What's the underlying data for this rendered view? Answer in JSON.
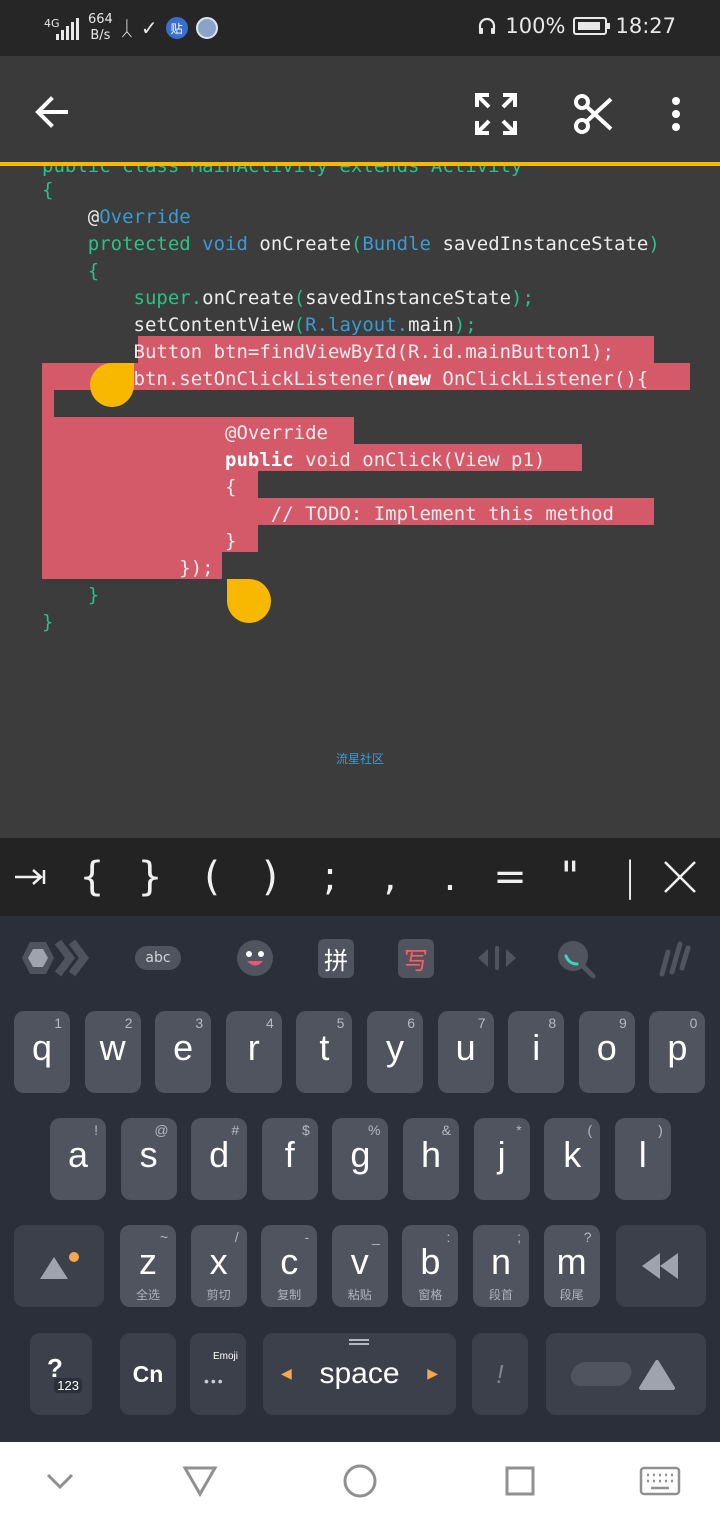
{
  "status_bar": {
    "network": "4G",
    "speed_value": "664",
    "speed_unit": "B/s",
    "tie_badge": "贴",
    "battery": "100%",
    "time": "18:27"
  },
  "code": {
    "line0": "public class MainActivity extends Activity",
    "line1": "{",
    "line2_at": "@",
    "line2_rest": "Override",
    "line3_kw": "protected",
    "line3_type": "void",
    "line3_name": "onCreate",
    "line3_paren": "(",
    "line3_param_type": "Bundle",
    "line3_param": "savedInstanceState",
    "line3_close": ")",
    "line4": "{",
    "line5_super": "super",
    "line5_dot": ".",
    "line5_call": "onCreate",
    "line5_open": "(",
    "line5_arg": "savedInstanceState",
    "line5_close": ");",
    "line6_call": "setContentView",
    "line6_open": "(",
    "line6_arg": "R.layout.",
    "line6_arg2": "main",
    "line6_close": ");",
    "line7": "Button btn=findViewById(R.id.mainButton1);",
    "line8_a": "btn.setOnClickListener(",
    "line8_new": "new",
    "line8_b": " OnClickListener(){",
    "line10": "@Override",
    "line11_kw": "public",
    "line11_rest": " void onClick(View p1)",
    "line12": "{",
    "line13": "// TODO: Implement this method",
    "line14": "}",
    "line15": "});",
    "line16": "}",
    "line17": "}"
  },
  "watermark": "流星社区",
  "symbols": {
    "s1": "{",
    "s2": "}",
    "s3": "(",
    "s4": ")",
    "s5": ";",
    "s6": ",",
    "s7": ".",
    "s8": "=",
    "s9": "\"",
    "s10": "|"
  },
  "toolbar": {
    "abc": "abc",
    "pinyin": "拼",
    "handwrite": "写"
  },
  "keys": {
    "row1": [
      {
        "l": "q",
        "h": "1"
      },
      {
        "l": "w",
        "h": "2"
      },
      {
        "l": "e",
        "h": "3"
      },
      {
        "l": "r",
        "h": "4"
      },
      {
        "l": "t",
        "h": "5"
      },
      {
        "l": "y",
        "h": "6"
      },
      {
        "l": "u",
        "h": "7"
      },
      {
        "l": "i",
        "h": "8"
      },
      {
        "l": "o",
        "h": "9"
      },
      {
        "l": "p",
        "h": "0"
      }
    ],
    "row2": [
      {
        "l": "a",
        "h": "!"
      },
      {
        "l": "s",
        "h": "@"
      },
      {
        "l": "d",
        "h": "#"
      },
      {
        "l": "f",
        "h": "$"
      },
      {
        "l": "g",
        "h": "%"
      },
      {
        "l": "h",
        "h": "&"
      },
      {
        "l": "j",
        "h": "*"
      },
      {
        "l": "k",
        "h": "("
      },
      {
        "l": "l",
        "h": ")"
      }
    ],
    "row3": [
      {
        "l": "z",
        "h": "~",
        "s": "全选"
      },
      {
        "l": "x",
        "h": "/",
        "s": "剪切"
      },
      {
        "l": "c",
        "h": "-",
        "s": "复制"
      },
      {
        "l": "v",
        "h": "_",
        "s": "粘贴"
      },
      {
        "l": "b",
        "h": ":",
        "s": "窗格"
      },
      {
        "l": "n",
        "h": ";",
        "s": "段首"
      },
      {
        "l": "m",
        "h": "?",
        "s": "段尾"
      }
    ],
    "num": "?",
    "num_sub": "123",
    "cn": "Cn",
    "emoji": "Emoji",
    "space": "space",
    "excl": "!"
  }
}
